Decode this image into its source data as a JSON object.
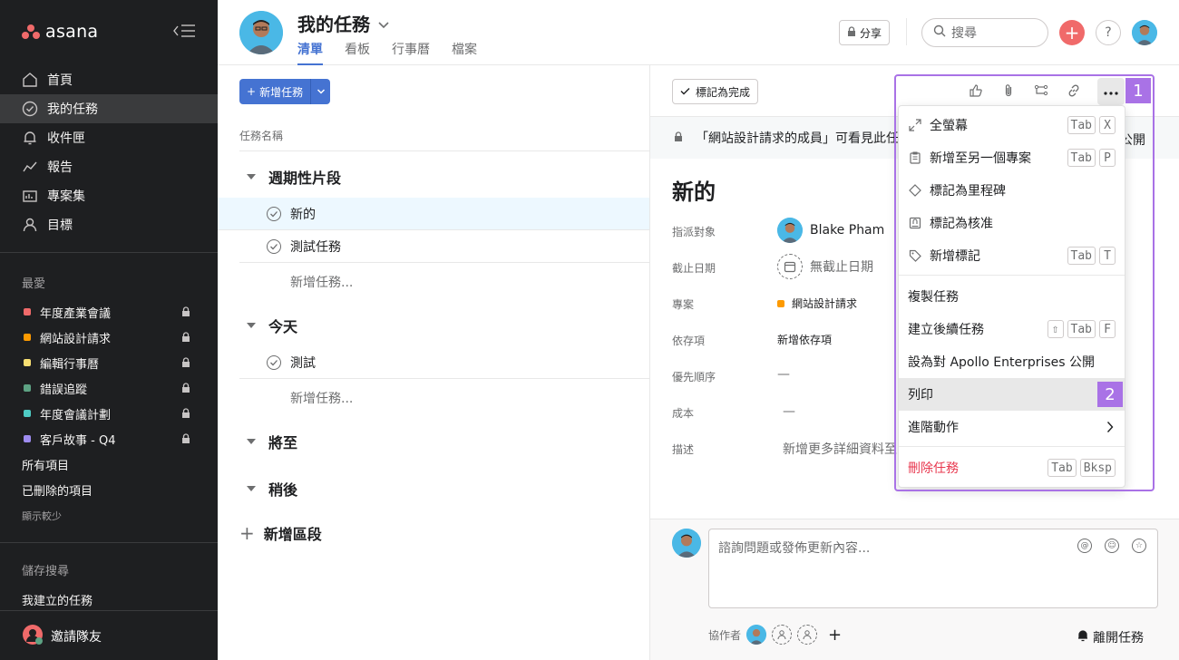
{
  "app": {
    "logo_text": "asana"
  },
  "sidebar": {
    "nav": [
      {
        "label": "首頁",
        "icon": "home-icon"
      },
      {
        "label": "我的任務",
        "icon": "check-circle-icon",
        "active": true
      },
      {
        "label": "收件匣",
        "icon": "bell-icon"
      },
      {
        "label": "報告",
        "icon": "chart-line-icon"
      },
      {
        "label": "專案集",
        "icon": "portfolio-icon"
      },
      {
        "label": "目標",
        "icon": "user-icon"
      }
    ],
    "favorites_label": "最愛",
    "favorites": [
      {
        "label": "年度產業會議",
        "color": "#f06a6a"
      },
      {
        "label": "網站設計請求",
        "color": "#fd9a00"
      },
      {
        "label": "編輯行事曆",
        "color": "#f8df72"
      },
      {
        "label": "錯誤追蹤",
        "color": "#5da283"
      },
      {
        "label": "年度會議計劃",
        "color": "#4ecbc4"
      },
      {
        "label": "客戶故事 - Q4",
        "color": "#9e8cf0"
      }
    ],
    "all_projects": "所有項目",
    "deleted_items": "已刪除的項目",
    "show_less": "顯示較少",
    "saved_search_label": "儲存搜尋",
    "my_created_tasks": "我建立的任務",
    "invite": "邀請隊友"
  },
  "header": {
    "title": "我的任務",
    "tabs": [
      "清單",
      "看板",
      "行事曆",
      "檔案"
    ],
    "share": "分享",
    "search_placeholder": "搜尋",
    "help": "?"
  },
  "list": {
    "add_task": "新增任務",
    "column_task_name": "任務名稱",
    "sections": [
      {
        "name": "週期性片段",
        "tasks": [
          "新的",
          "測試任務"
        ],
        "add": "新增任務..."
      },
      {
        "name": "今天",
        "tasks": [
          "測試"
        ],
        "add": "新增任務..."
      },
      {
        "name": "將至"
      },
      {
        "name": "稍後"
      }
    ],
    "add_section": "新增區段"
  },
  "detail": {
    "mark_complete": "標記為完成",
    "banner": "「網站設計請求的成員」可看見此任",
    "banner_right": "公開",
    "title": "新的",
    "fields": {
      "assignee_label": "指派對象",
      "assignee_value": "Blake Pham",
      "due_label": "截止日期",
      "due_value": "無截止日期",
      "project_label": "專案",
      "project_value": "網站設計請求",
      "dependencies_label": "依存項",
      "dependencies_value": "新增依存項",
      "priority_label": "優先順序",
      "priority_value": "—",
      "cost_label": "成本",
      "cost_value": "—",
      "description_label": "描述",
      "description_value": "新增更多詳細資料至"
    },
    "comment_placeholder": "諮詢問題或發佈更新內容...",
    "collaborators_label": "協作者",
    "leave_task": "離開任務"
  },
  "menu": {
    "items": [
      {
        "label": "全螢幕",
        "keys": [
          "Tab",
          "X"
        ]
      },
      {
        "label": "新增至另一個專案",
        "keys": [
          "Tab",
          "P"
        ]
      },
      {
        "label": "標記為里程碑"
      },
      {
        "label": "標記為核准"
      },
      {
        "label": "新增標記",
        "keys": [
          "Tab",
          "T"
        ]
      },
      {
        "label": "複製任務"
      },
      {
        "label": "建立後續任務",
        "keys": [
          "⇧",
          "Tab",
          "F"
        ]
      },
      {
        "label": "設為對 Apollo Enterprises 公開"
      },
      {
        "label": "列印"
      },
      {
        "label": "進階動作"
      },
      {
        "label": "刪除任務",
        "keys": [
          "Tab",
          "Bksp"
        ]
      }
    ]
  },
  "annotations": {
    "one": "1",
    "two": "2"
  },
  "colors": {
    "accent": "#4573d2",
    "highlight": "#a972e6",
    "danger": "#e8384f",
    "sidebar": "#1e1f21"
  }
}
